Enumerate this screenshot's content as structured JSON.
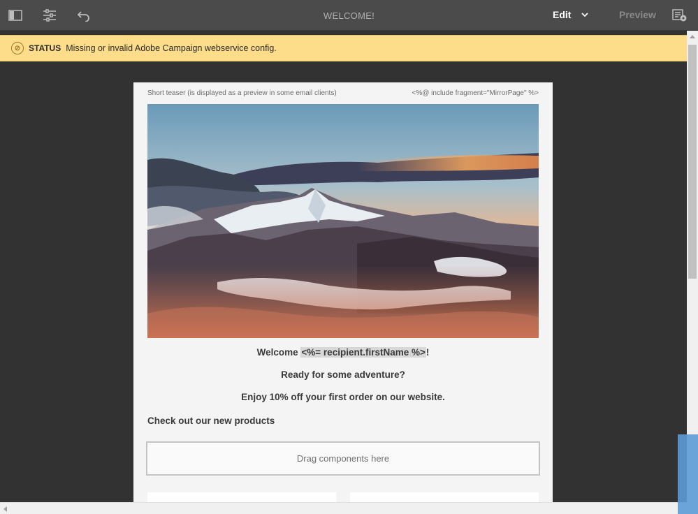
{
  "toolbar": {
    "title": "WELCOME!",
    "edit_label": "Edit",
    "preview_label": "Preview",
    "icons": [
      "sidebar-toggle-icon",
      "settings-sliders-icon",
      "undo-icon",
      "chevron-down-icon",
      "list-settings-icon"
    ]
  },
  "status": {
    "label": "STATUS",
    "message": "Missing or invalid Adobe Campaign webservice config."
  },
  "email": {
    "teaser": "Short teaser (is displayed as a preview in some email clients)",
    "mirror_fragment": "<%@ include fragment=\"MirrorPage\" %>",
    "welcome_prefix": "Welcome ",
    "welcome_token": "<%= recipient.firstName %>",
    "welcome_suffix": "!",
    "line2": "Ready for some adventure?",
    "line3": "Enjoy 10% off your first order on our website.",
    "subhead": "Check out our new products",
    "dropzone": "Drag components here"
  },
  "colors": {
    "toolbar_bg": "#4b4b4b",
    "status_bg": "#fddc8a",
    "canvas_bg": "#323232",
    "email_bg": "#f4f4f4"
  }
}
